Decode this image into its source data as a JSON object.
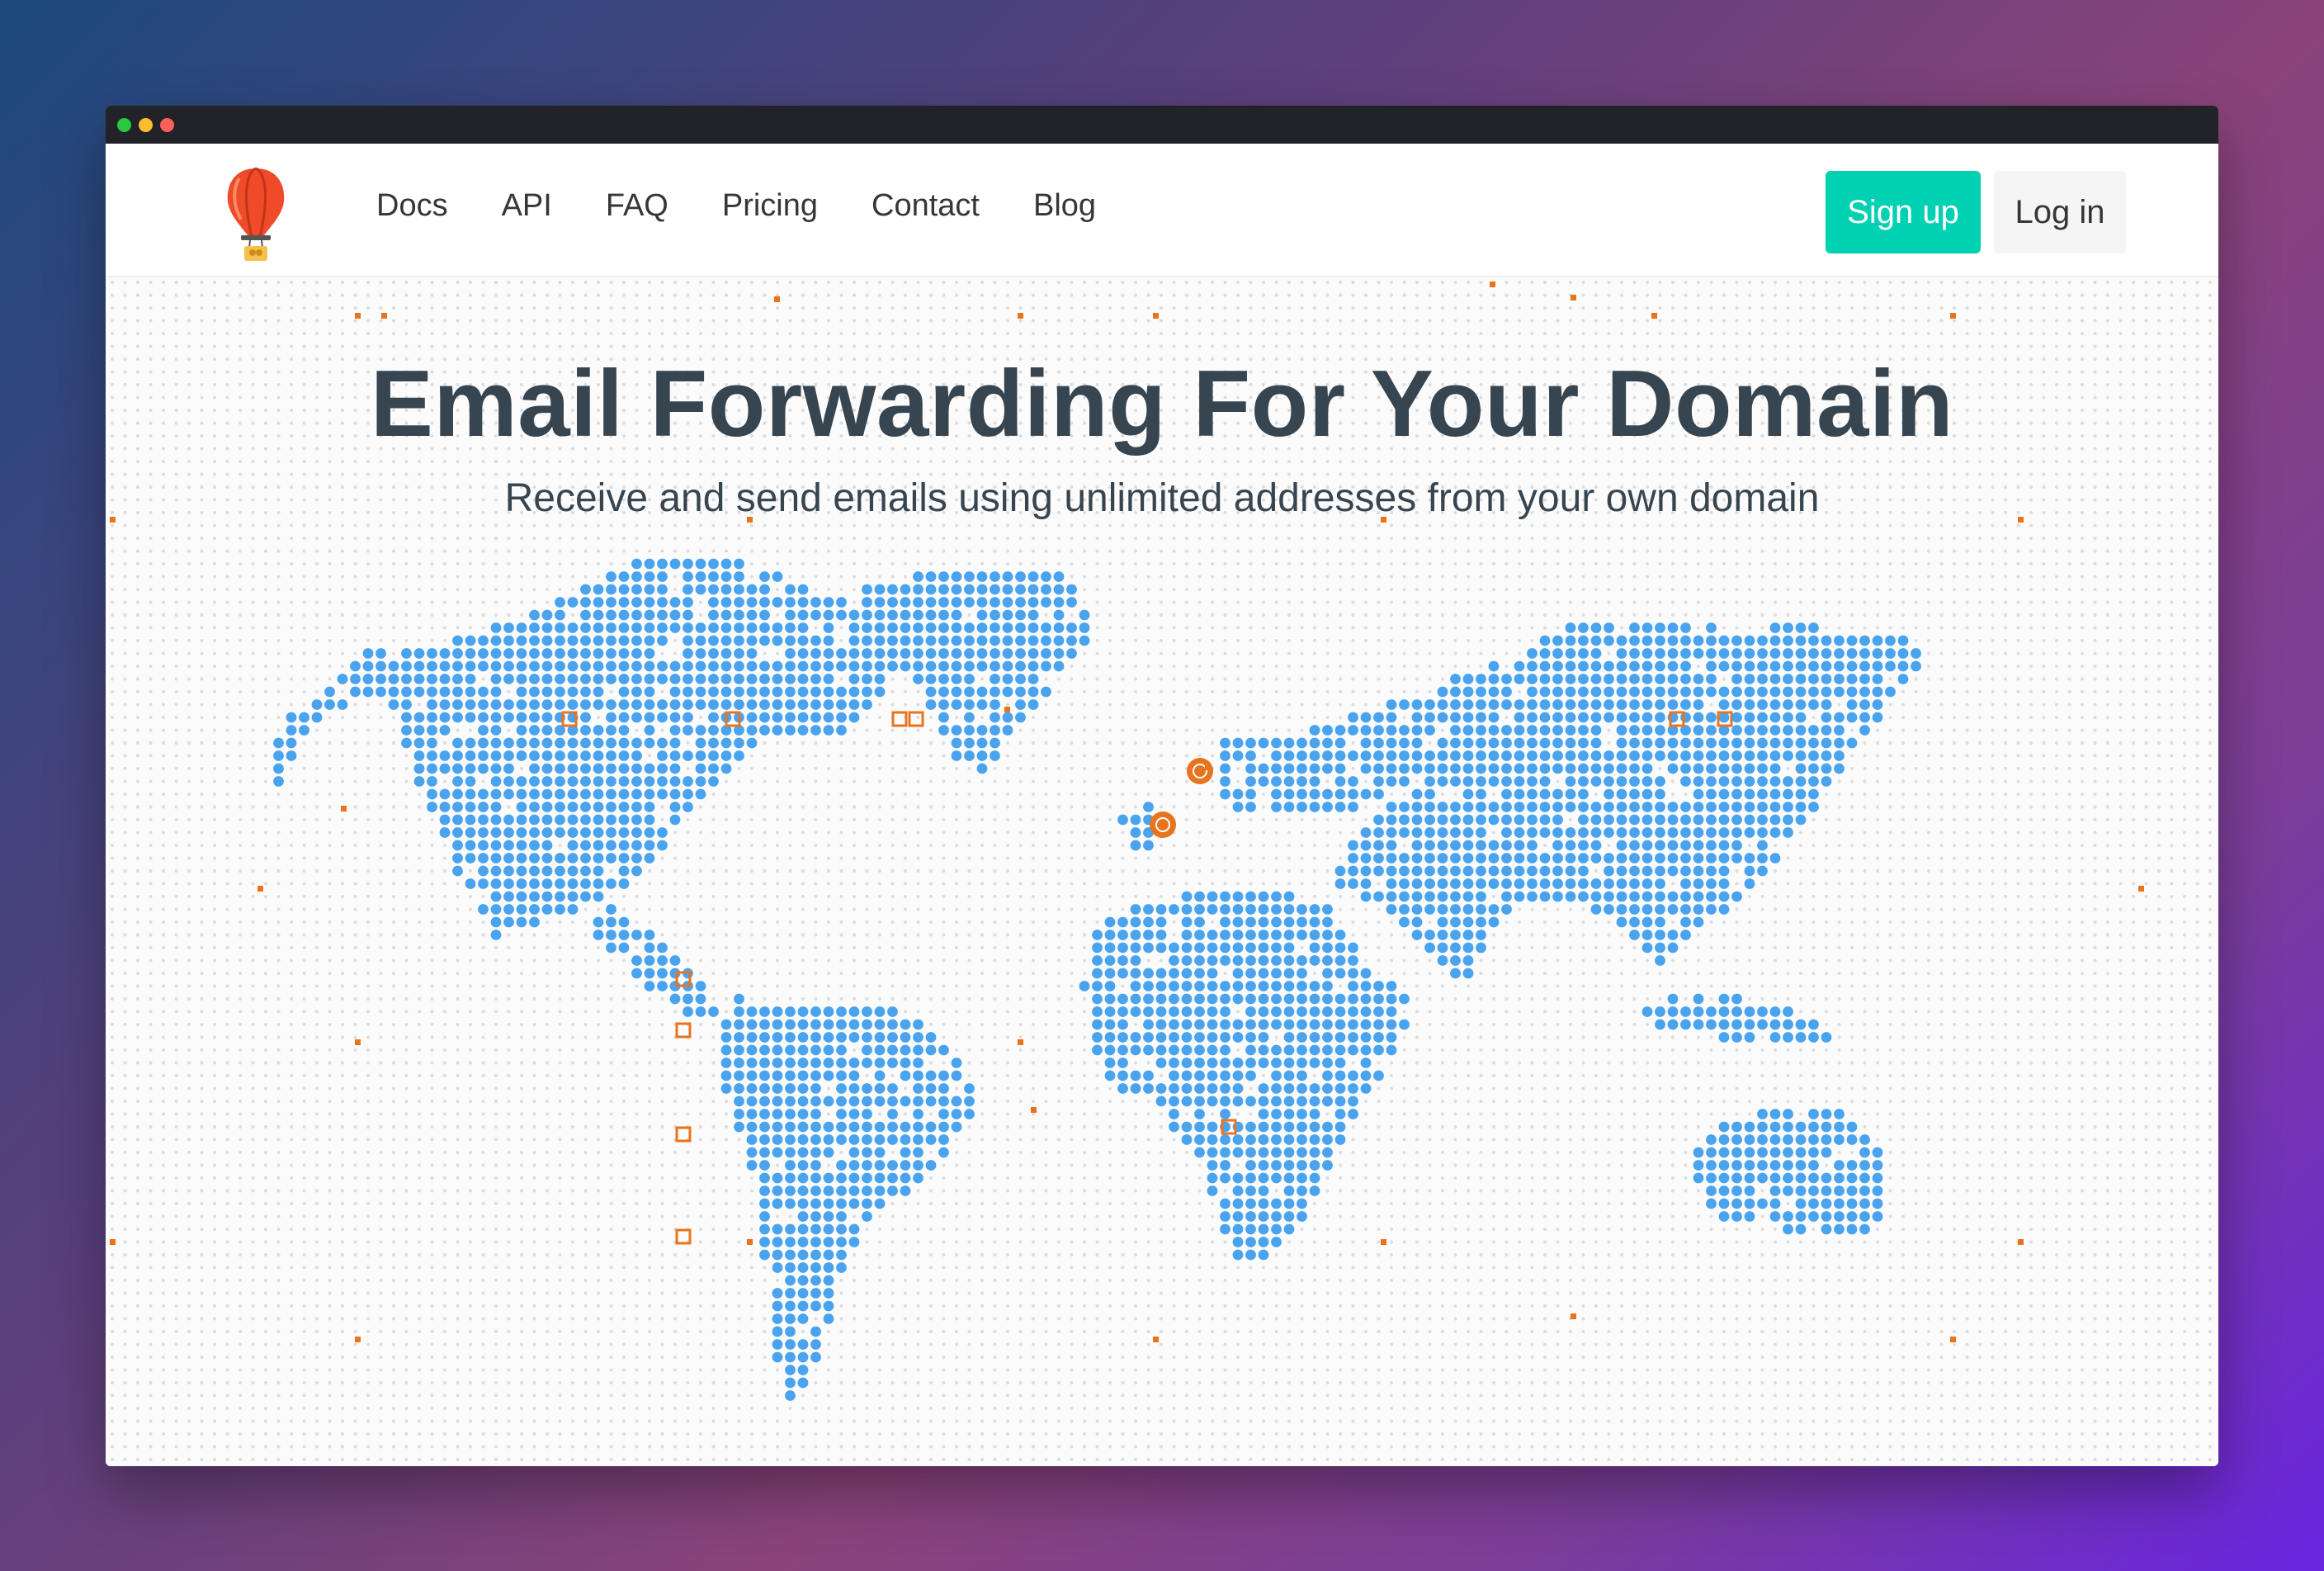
{
  "window": {
    "traffic_lights": [
      "#27c93f",
      "#ffbd2e",
      "#ff5f56"
    ]
  },
  "navbar": {
    "logo_icon": "hot-air-balloon-icon",
    "links": [
      "Docs",
      "API",
      "FAQ",
      "Pricing",
      "Contact",
      "Blog"
    ],
    "signup_label": "Sign up",
    "login_label": "Log in"
  },
  "hero": {
    "title": "Email Forwarding For Your Domain",
    "subtitle": "Receive and send emails using unlimited addresses from your own domain",
    "map_icon": "world-dot-map",
    "marker_icons": [
      "email-marker-icon",
      "server-marker-icon"
    ]
  },
  "colors": {
    "accent": "#00d1b2",
    "map_dots": "#4aa3ee",
    "background_dots": "#dcdcdc",
    "markers": "#e8741e",
    "heading": "#374550"
  }
}
